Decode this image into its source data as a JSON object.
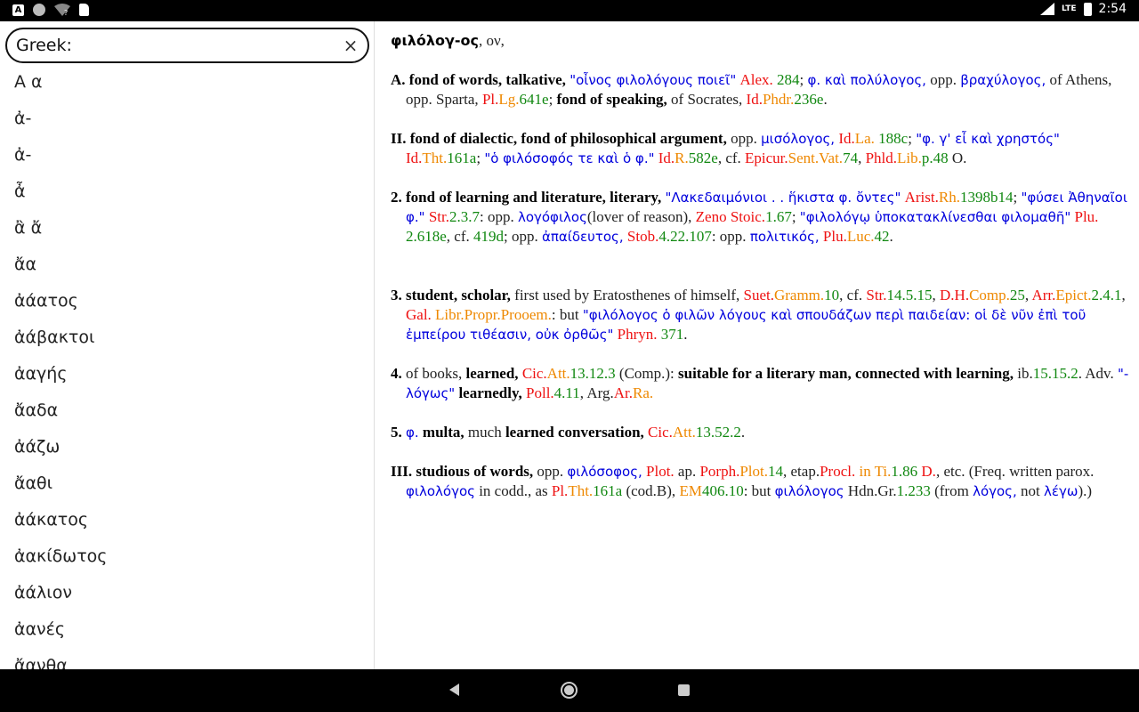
{
  "status_bar": {
    "left_icons": [
      "a-icon",
      "circle-icon",
      "wifi-question-icon",
      "sdcard-icon"
    ],
    "a_label": "A",
    "lte": "LTE",
    "time": "2:54"
  },
  "search": {
    "value": "Greek:",
    "clear_glyph": "×"
  },
  "word_list": [
    "Α α",
    "ἀ-",
    "ἀ-",
    "ἆ",
    "ἂ ἄ",
    "ἄα",
    "ἀάατος",
    "ἀάβακτοι",
    "ἀαγής",
    "ἄαδα",
    "ἀάζω",
    "ἄαθι",
    "ἀάκατος",
    "ἀακίδωτος",
    "ἀάλιον",
    "ἀανές",
    "ἄανθα"
  ],
  "entry": {
    "headword": "φιλόλογ-ος",
    "headword_suffix": ", ον,",
    "senses": [
      {
        "label": "A.",
        "segments": [
          {
            "t": " fond of words, talkative, ",
            "s": "b"
          },
          {
            "t": "\"οἶνος φιλολόγους ποιεῖ\"",
            "s": "g"
          },
          {
            "t": " Alex.",
            "s": "r"
          },
          {
            "t": " 284",
            "s": "n"
          },
          {
            "t": "; ",
            "s": ""
          },
          {
            "t": "φ. καὶ πολύλογος,",
            "s": "g"
          },
          {
            "t": " opp. ",
            "s": ""
          },
          {
            "t": "βραχύλογος,",
            "s": "g"
          },
          {
            "t": " of Athens, opp. Sparta, ",
            "s": ""
          },
          {
            "t": "Pl.",
            "s": "r"
          },
          {
            "t": "Lg.",
            "s": "o"
          },
          {
            "t": "641e",
            "s": "n"
          },
          {
            "t": "; ",
            "s": ""
          },
          {
            "t": "fond of speaking,",
            "s": "b"
          },
          {
            "t": " of Socrates, ",
            "s": ""
          },
          {
            "t": "Id.",
            "s": "r"
          },
          {
            "t": "Phdr.",
            "s": "o"
          },
          {
            "t": "236e",
            "s": "n"
          },
          {
            "t": ".",
            "s": ""
          }
        ]
      },
      {
        "label": "II.",
        "segments": [
          {
            "t": " fond of dialectic, fond of philosophical argument,",
            "s": "b"
          },
          {
            "t": " opp. ",
            "s": ""
          },
          {
            "t": "μισόλογος,",
            "s": "g"
          },
          {
            "t": " Id.",
            "s": "r"
          },
          {
            "t": "La.",
            "s": "o"
          },
          {
            "t": " 188c",
            "s": "n"
          },
          {
            "t": "; ",
            "s": ""
          },
          {
            "t": "\"φ. γ' εἶ καὶ χρηστός\"",
            "s": "g"
          },
          {
            "t": " Id.",
            "s": "r"
          },
          {
            "t": "Tht.",
            "s": "o"
          },
          {
            "t": "161a",
            "s": "n"
          },
          {
            "t": "; ",
            "s": ""
          },
          {
            "t": "\"ὁ φιλόσοφός τε καὶ ὁ φ.\"",
            "s": "g"
          },
          {
            "t": " Id.",
            "s": "r"
          },
          {
            "t": "R.",
            "s": "o"
          },
          {
            "t": "582e",
            "s": "n"
          },
          {
            "t": ", cf. ",
            "s": ""
          },
          {
            "t": "Epicur.",
            "s": "r"
          },
          {
            "t": "Sent.Vat.",
            "s": "o"
          },
          {
            "t": "74",
            "s": "n"
          },
          {
            "t": ", ",
            "s": ""
          },
          {
            "t": "Phld.",
            "s": "r"
          },
          {
            "t": "Lib.",
            "s": "o"
          },
          {
            "t": "p.48",
            "s": "n"
          },
          {
            "t": " O.",
            "s": ""
          }
        ]
      },
      {
        "label": "2.",
        "segments": [
          {
            "t": " fond of learning and literature, literary, ",
            "s": "b"
          },
          {
            "t": "\"Λακεδαιμόνιοι . . ἥκιστα φ. ὄντες\"",
            "s": "g"
          },
          {
            "t": " Arist.",
            "s": "r"
          },
          {
            "t": "Rh.",
            "s": "o"
          },
          {
            "t": "1398b14",
            "s": "n"
          },
          {
            "t": "; ",
            "s": ""
          },
          {
            "t": "\"φύσει Ἀθηναῖοι φ.\"",
            "s": "g"
          },
          {
            "t": " Str.",
            "s": "r"
          },
          {
            "t": "2.3.7",
            "s": "n"
          },
          {
            "t": ": opp. ",
            "s": ""
          },
          {
            "t": "λογόφιλος",
            "s": "g"
          },
          {
            "t": "(lover of reason), ",
            "s": ""
          },
          {
            "t": "Zeno Stoic.",
            "s": "r"
          },
          {
            "t": "1.67",
            "s": "n"
          },
          {
            "t": "; ",
            "s": ""
          },
          {
            "t": "\"φιλολόγῳ ὑποκατακλίνεσθαι φιλομαθῆ\"",
            "s": "g"
          },
          {
            "t": " Plu.",
            "s": "r"
          },
          {
            "t": " 2.618e",
            "s": "n"
          },
          {
            "t": ", cf. ",
            "s": ""
          },
          {
            "t": "419d",
            "s": "n"
          },
          {
            "t": "; opp. ",
            "s": ""
          },
          {
            "t": "ἀπαίδευτος,",
            "s": "g"
          },
          {
            "t": " Stob.",
            "s": "r"
          },
          {
            "t": "4.22.107",
            "s": "n"
          },
          {
            "t": ": opp. ",
            "s": ""
          },
          {
            "t": "πολιτικός,",
            "s": "g"
          },
          {
            "t": " Plu.",
            "s": "r"
          },
          {
            "t": "Luc.",
            "s": "o"
          },
          {
            "t": "42",
            "s": "n"
          },
          {
            "t": ".",
            "s": ""
          }
        ]
      },
      {
        "label": "3.",
        "segments": [
          {
            "t": " student, scholar,",
            "s": "b"
          },
          {
            "t": " first used by Eratosthenes of himself, ",
            "s": ""
          },
          {
            "t": "Suet.",
            "s": "r"
          },
          {
            "t": "Gramm.",
            "s": "o"
          },
          {
            "t": "10",
            "s": "n"
          },
          {
            "t": ", cf. ",
            "s": ""
          },
          {
            "t": "Str.",
            "s": "r"
          },
          {
            "t": "14.5.15",
            "s": "n"
          },
          {
            "t": ", ",
            "s": ""
          },
          {
            "t": "D.H.",
            "s": "r"
          },
          {
            "t": "Comp.",
            "s": "o"
          },
          {
            "t": "25",
            "s": "n"
          },
          {
            "t": ", ",
            "s": ""
          },
          {
            "t": "Arr.",
            "s": "r"
          },
          {
            "t": "Epict.",
            "s": "o"
          },
          {
            "t": "2.4.1",
            "s": "n"
          },
          {
            "t": ", ",
            "s": ""
          },
          {
            "t": "Gal.",
            "s": "r"
          },
          {
            "t": " Libr.Propr.Prooem.",
            "s": "o"
          },
          {
            "t": ": but ",
            "s": ""
          },
          {
            "t": "\"φιλόλογος ὁ φιλῶν λόγους καὶ σπουδάζων περὶ παιδείαν: οἱ δὲ νῦν ἐπὶ τοῦ ἐμπείρου τιθέασιν, οὐκ ὀρθῶς\"",
            "s": "g"
          },
          {
            "t": " Phryn.",
            "s": "r"
          },
          {
            "t": " 371",
            "s": "n"
          },
          {
            "t": ".",
            "s": ""
          }
        ]
      },
      {
        "label": "4.",
        "segments": [
          {
            "t": " of books, ",
            "s": ""
          },
          {
            "t": "learned,",
            "s": "b"
          },
          {
            "t": " Cic.",
            "s": "r"
          },
          {
            "t": "Att.",
            "s": "o"
          },
          {
            "t": "13.12.3",
            "s": "n"
          },
          {
            "t": " (Comp.): ",
            "s": ""
          },
          {
            "t": "suitable for a literary man, connected with learning,",
            "s": "b"
          },
          {
            "t": " ib.",
            "s": ""
          },
          {
            "t": "15.15.2",
            "s": "n"
          },
          {
            "t": ". Adv. ",
            "s": ""
          },
          {
            "t": "\"-λόγως\"",
            "s": "g"
          },
          {
            "t": " learnedly,",
            "s": "b"
          },
          {
            "t": " Poll.",
            "s": "r"
          },
          {
            "t": "4.11",
            "s": "n"
          },
          {
            "t": ", Arg.",
            "s": ""
          },
          {
            "t": "Ar.",
            "s": "r"
          },
          {
            "t": "Ra.",
            "s": "o"
          }
        ]
      },
      {
        "label": "5.",
        "segments": [
          {
            "t": " ",
            "s": ""
          },
          {
            "t": "φ.",
            "s": "g"
          },
          {
            "t": " multa,",
            "s": "b"
          },
          {
            "t": " much ",
            "s": ""
          },
          {
            "t": "learned conversation,",
            "s": "b"
          },
          {
            "t": " Cic.",
            "s": "r"
          },
          {
            "t": "Att.",
            "s": "o"
          },
          {
            "t": "13.52.2",
            "s": "n"
          },
          {
            "t": ".",
            "s": ""
          }
        ]
      },
      {
        "label": "III.",
        "segments": [
          {
            "t": " studious of words,",
            "s": "b"
          },
          {
            "t": " opp. ",
            "s": ""
          },
          {
            "t": "φιλόσοφος,",
            "s": "g"
          },
          {
            "t": " Plot.",
            "s": "r"
          },
          {
            "t": " ap. ",
            "s": ""
          },
          {
            "t": "Porph.",
            "s": "r"
          },
          {
            "t": "Plot.",
            "s": "o"
          },
          {
            "t": "14",
            "s": "n"
          },
          {
            "t": ", etap.",
            "s": ""
          },
          {
            "t": "Procl.",
            "s": "r"
          },
          {
            "t": " in Ti.",
            "s": "o"
          },
          {
            "t": "1.86",
            "s": "n"
          },
          {
            "t": " D.",
            "s": "r"
          },
          {
            "t": ", etc. (Freq. written parox. ",
            "s": ""
          },
          {
            "t": "φιλολόγος",
            "s": "g"
          },
          {
            "t": " in codd., as ",
            "s": ""
          },
          {
            "t": "Pl.",
            "s": "r"
          },
          {
            "t": "Tht.",
            "s": "o"
          },
          {
            "t": "161a",
            "s": "n"
          },
          {
            "t": " (cod.B), ",
            "s": ""
          },
          {
            "t": "EM",
            "s": "o"
          },
          {
            "t": "406.10",
            "s": "n"
          },
          {
            "t": ": but ",
            "s": ""
          },
          {
            "t": "φιλόλογος",
            "s": "g"
          },
          {
            "t": " Hdn.Gr.",
            "s": ""
          },
          {
            "t": "1.233",
            "s": "n"
          },
          {
            "t": " (from ",
            "s": ""
          },
          {
            "t": "λόγος,",
            "s": "g"
          },
          {
            "t": " not ",
            "s": ""
          },
          {
            "t": "λέγω",
            "s": "g"
          },
          {
            "t": ").)",
            "s": ""
          }
        ]
      }
    ]
  },
  "colors": {
    "greek": "#0000dd",
    "author": "#ee1111",
    "work": "#ee8800",
    "number": "#118811"
  },
  "nav_bar": {
    "buttons": [
      "back-icon",
      "home-icon",
      "recents-icon"
    ]
  }
}
